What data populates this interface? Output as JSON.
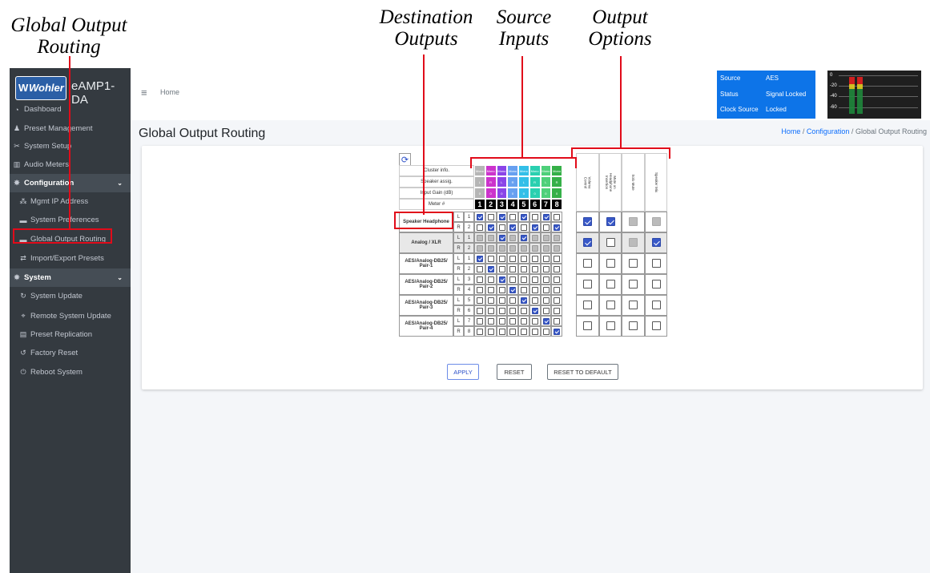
{
  "annotations": {
    "global_output_routing": "Global Output\nRouting",
    "destination_outputs": "Destination\nOutputs",
    "source_inputs": "Source\nInputs",
    "output_options": "Output\nOptions"
  },
  "brand": {
    "logo": "Wohler",
    "product": "eAMP1-DA"
  },
  "sidebar": {
    "items": [
      {
        "icon": "dashboard-icon",
        "glyph": "◔",
        "label": "Dashboard"
      },
      {
        "icon": "users-icon",
        "glyph": "♟",
        "label": "Preset Management"
      },
      {
        "icon": "tools-icon",
        "glyph": "✂",
        "label": "System Setup"
      },
      {
        "icon": "chart-icon",
        "glyph": "▥",
        "label": "Audio Meters"
      },
      {
        "icon": "gear-icon",
        "glyph": "✸",
        "label": "Configuration"
      },
      {
        "icon": "network-icon",
        "glyph": "⁂",
        "label": "Mgmt IP Address"
      },
      {
        "icon": "keyboard-icon",
        "glyph": "▬",
        "label": "System Preferences"
      },
      {
        "icon": "keyboard-icon",
        "glyph": "▬",
        "label": "Global Output Routing"
      },
      {
        "icon": "exchange-icon",
        "glyph": "⇄",
        "label": "Import/Export Presets"
      },
      {
        "icon": "gears-icon",
        "glyph": "✸",
        "label": "System"
      },
      {
        "icon": "sync-icon",
        "glyph": "↻",
        "label": "System Update"
      },
      {
        "icon": "satellite-icon",
        "glyph": "⌖",
        "label": "Remote System Update"
      },
      {
        "icon": "clone-icon",
        "glyph": "▤",
        "label": "Preset Replication"
      },
      {
        "icon": "undo-icon",
        "glyph": "↺",
        "label": "Factory Reset"
      },
      {
        "icon": "power-icon",
        "glyph": "⏻",
        "label": "Reboot System"
      }
    ]
  },
  "header": {
    "menu_glyph": "≡",
    "home": "Home"
  },
  "status": {
    "rows": [
      {
        "label": "Source",
        "value": "AES"
      },
      {
        "label": "Status",
        "value": "Signal Locked"
      },
      {
        "label": "Clock Source",
        "value": "Locked"
      }
    ]
  },
  "meter": {
    "ticks": [
      "0",
      "-20",
      "-40",
      "-60"
    ],
    "levels": [
      0.7,
      0.7
    ]
  },
  "page": {
    "title": "Global Output Routing",
    "breadcrumb": {
      "home": "Home",
      "sep": " / ",
      "config": "Configuration",
      "current": "Global Output Routing"
    }
  },
  "routing": {
    "refresh_glyph": "⟳",
    "row_labels": {
      "cluster": "Cluster info.",
      "speaker": "Speaker assig.",
      "gain": "Input Gain (dB)",
      "meter": "Meter #"
    },
    "channels": [
      {
        "cluster": "Mono",
        "speaker": "L",
        "gain": "0",
        "meter": "1",
        "color": "#b5b5b5"
      },
      {
        "cluster": "Mono",
        "speaker": "R",
        "gain": "0",
        "meter": "2",
        "color": "#cc33cc"
      },
      {
        "cluster": "Mono",
        "speaker": "L",
        "gain": "0",
        "meter": "3",
        "color": "#8a45e8"
      },
      {
        "cluster": "Mono",
        "speaker": "R",
        "gain": "0",
        "meter": "4",
        "color": "#67a0f0"
      },
      {
        "cluster": "Mono",
        "speaker": "L",
        "gain": "0",
        "meter": "5",
        "color": "#33bfe8"
      },
      {
        "cluster": "Mono",
        "speaker": "R",
        "gain": "0",
        "meter": "6",
        "color": "#2ad0b0"
      },
      {
        "cluster": "Mono",
        "speaker": "L",
        "gain": "0",
        "meter": "7",
        "color": "#4ed07a"
      },
      {
        "cluster": "Mono",
        "speaker": "R",
        "gain": "0",
        "meter": "8",
        "color": "#35b048"
      }
    ],
    "options": [
      "Volume Control",
      "Mute on Headphone Insertion",
      "Solo Mute",
      "Speaker Mix"
    ],
    "outputs": [
      {
        "name": "Speaker Headphone",
        "ch": [
          {
            "side": "L",
            "num": "1"
          },
          {
            "side": "R",
            "num": "2"
          }
        ],
        "matrix": [
          [
            1,
            0,
            1,
            0,
            1,
            0,
            1,
            0
          ],
          [
            0,
            1,
            0,
            1,
            0,
            1,
            0,
            1
          ]
        ],
        "disabled": false,
        "opts": [
          1,
          1,
          2,
          2
        ]
      },
      {
        "name": "Analog / XLR",
        "ch": [
          {
            "side": "L",
            "num": "1"
          },
          {
            "side": "R",
            "num": "2"
          }
        ],
        "matrix": [
          [
            2,
            2,
            1,
            2,
            1,
            2,
            2,
            2
          ],
          [
            2,
            2,
            2,
            2,
            2,
            2,
            2,
            2
          ]
        ],
        "disabled": true,
        "opts": [
          1,
          0,
          2,
          1
        ]
      },
      {
        "name": "AES/Analog-DB25/ Pair-1",
        "ch": [
          {
            "side": "L",
            "num": "1"
          },
          {
            "side": "R",
            "num": "2"
          }
        ],
        "matrix": [
          [
            1,
            0,
            0,
            0,
            0,
            0,
            0,
            0
          ],
          [
            0,
            1,
            0,
            0,
            0,
            0,
            0,
            0
          ]
        ],
        "disabled": false,
        "opts": [
          0,
          0,
          0,
          0
        ]
      },
      {
        "name": "AES/Analog-DB25/ Pair-2",
        "ch": [
          {
            "side": "L",
            "num": "3"
          },
          {
            "side": "R",
            "num": "4"
          }
        ],
        "matrix": [
          [
            0,
            0,
            1,
            0,
            0,
            0,
            0,
            0
          ],
          [
            0,
            0,
            0,
            1,
            0,
            0,
            0,
            0
          ]
        ],
        "disabled": false,
        "opts": [
          0,
          0,
          0,
          0
        ]
      },
      {
        "name": "AES/Analog-DB25/ Pair-3",
        "ch": [
          {
            "side": "L",
            "num": "5"
          },
          {
            "side": "R",
            "num": "6"
          }
        ],
        "matrix": [
          [
            0,
            0,
            0,
            0,
            1,
            0,
            0,
            0
          ],
          [
            0,
            0,
            0,
            0,
            0,
            1,
            0,
            0
          ]
        ],
        "disabled": false,
        "opts": [
          0,
          0,
          0,
          0
        ]
      },
      {
        "name": "AES/Analog-DB25/ Pair-4",
        "ch": [
          {
            "side": "L",
            "num": "7"
          },
          {
            "side": "R",
            "num": "8"
          }
        ],
        "matrix": [
          [
            0,
            0,
            0,
            0,
            0,
            0,
            1,
            0
          ],
          [
            0,
            0,
            0,
            0,
            0,
            0,
            0,
            1
          ]
        ],
        "disabled": false,
        "opts": [
          0,
          0,
          0,
          0
        ]
      }
    ]
  },
  "buttons": {
    "apply": "APPLY",
    "reset": "RESET",
    "reset_default": "RESET TO DEFAULT"
  },
  "colors": {
    "sidebar": "#343a40",
    "accent": "#e10b1a",
    "status_panel": "#0d74e8",
    "checked": "#3858c8"
  }
}
